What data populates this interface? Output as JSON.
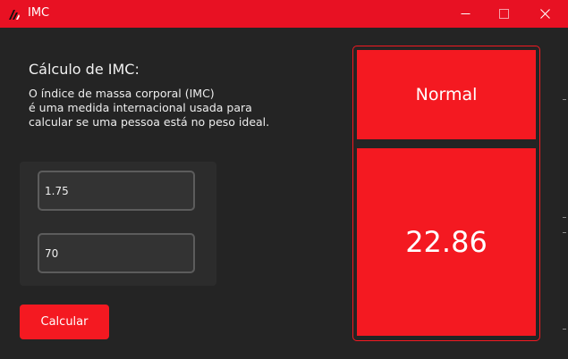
{
  "window": {
    "title": "IMC",
    "icon": "app-logo-icon",
    "controls": [
      "minimize-icon",
      "maximize-icon",
      "close-icon"
    ],
    "accent_color": "#e81123"
  },
  "main": {
    "heading": "Cálculo de IMC:",
    "description": "O índice de massa corporal (IMC)\né uma medida internacional usada para\ncalcular se uma pessoa está no peso ideal.",
    "height_value": "1.75",
    "weight_value": "70",
    "calculate_label": "Calcular"
  },
  "result": {
    "status": "Normal",
    "value": "22.86",
    "color": "#f41921"
  }
}
